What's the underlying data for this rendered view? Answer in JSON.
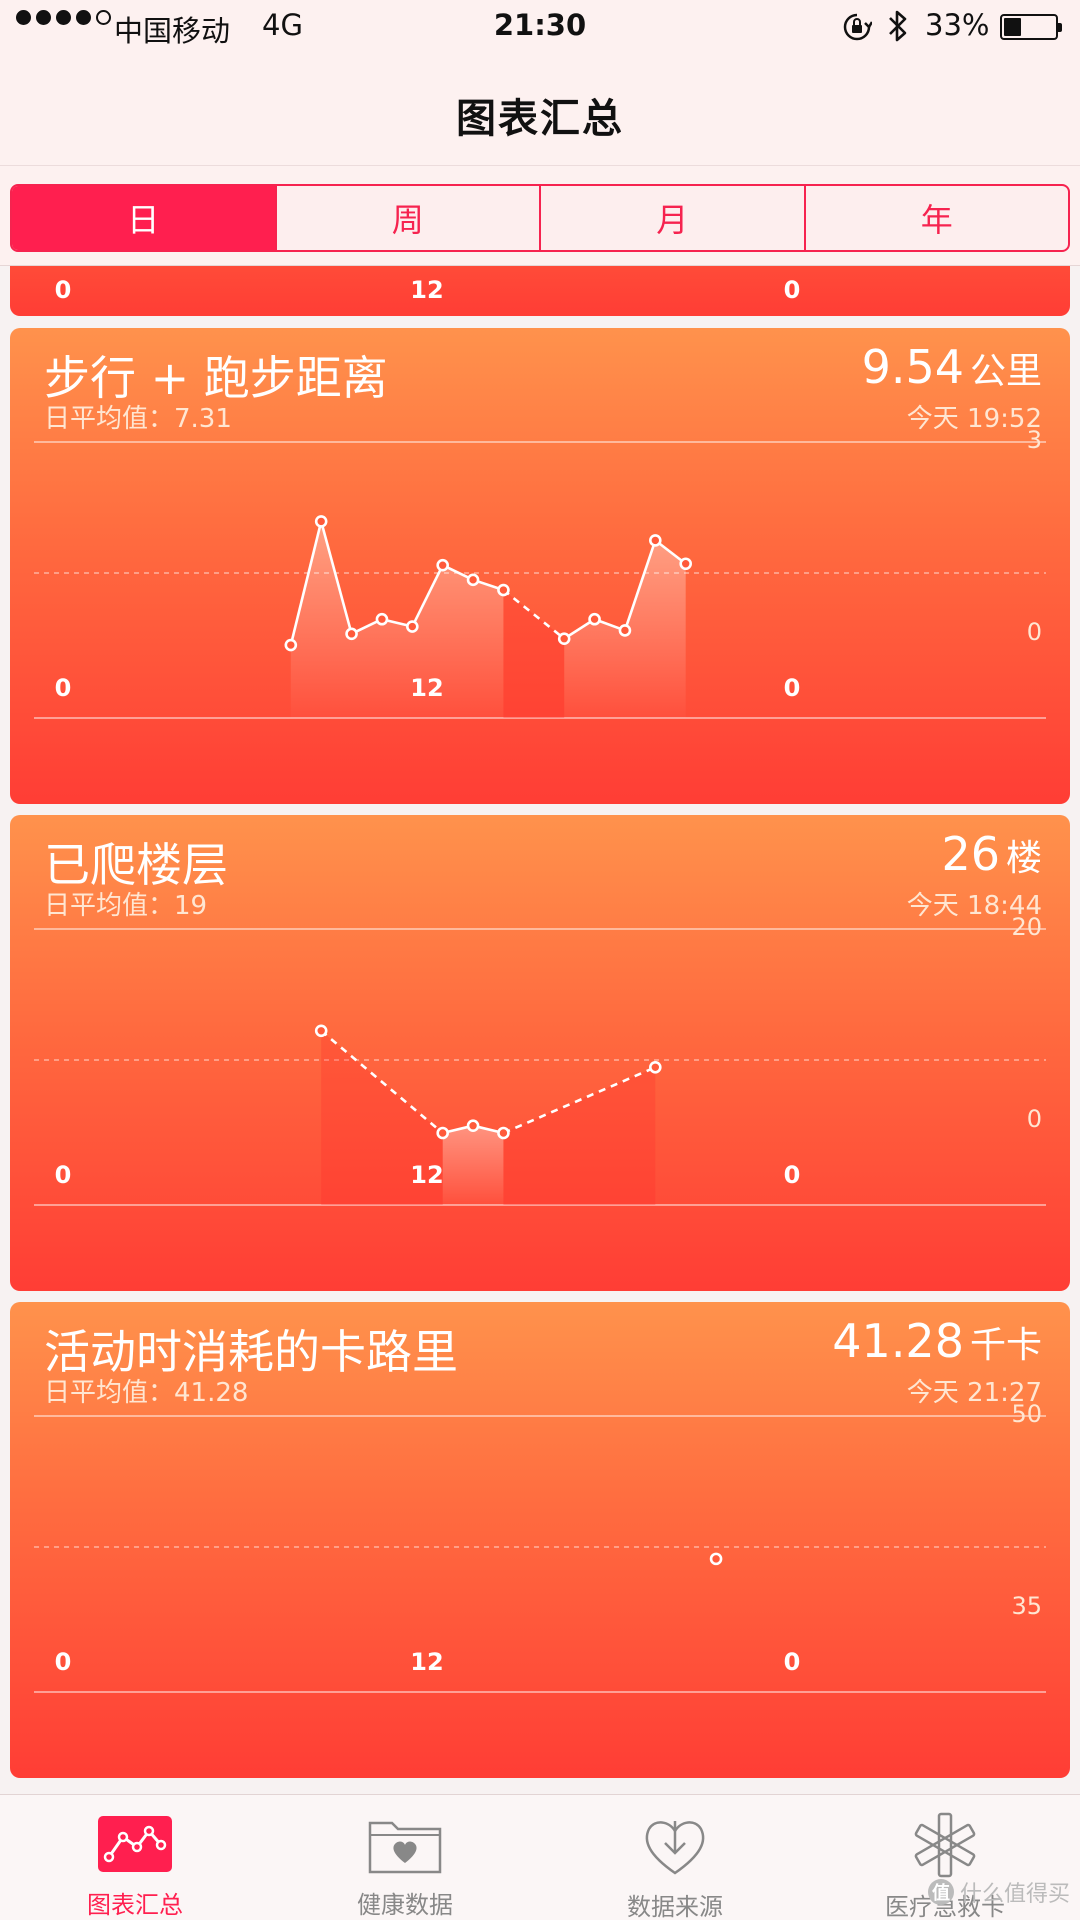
{
  "status_bar": {
    "carrier": "中国移动",
    "network": "4G",
    "time": "21:30",
    "battery_percent": "33%",
    "battery_level": 0.33,
    "signal_bars": 4,
    "icons": [
      "rotation-lock-icon",
      "bluetooth-icon",
      "battery-icon"
    ]
  },
  "nav": {
    "title": "图表汇总"
  },
  "segments": {
    "items": [
      {
        "label": "日",
        "active": true
      },
      {
        "label": "周",
        "active": false
      },
      {
        "label": "月",
        "active": false
      },
      {
        "label": "年",
        "active": false
      }
    ]
  },
  "prev_card": {
    "xticks": [
      "0",
      "12",
      "0"
    ]
  },
  "cards": [
    {
      "title": "步行 + 跑步距离",
      "avg": "日平均值：7.31",
      "value": "9.54",
      "unit": "公里",
      "time": "今天 19:52",
      "ymax_label": "3",
      "ymin_label": "0",
      "xticks": [
        "0",
        "12",
        "0"
      ]
    },
    {
      "title": "已爬楼层",
      "avg": "日平均值：19",
      "value": "26",
      "unit": "楼",
      "time": "今天 18:44",
      "ymax_label": "20",
      "ymin_label": "0",
      "xticks": [
        "0",
        "12",
        "0"
      ]
    },
    {
      "title": "活动时消耗的卡路里",
      "avg": "日平均值：41.28",
      "value": "41.28",
      "unit": "千卡",
      "time": "今天 21:27",
      "ymax_label": "50",
      "ymin_label": "35",
      "xticks": [
        "0",
        "12",
        "0"
      ]
    }
  ],
  "chart_data": [
    {
      "type": "line",
      "x_unit": "hour",
      "xlim": [
        0,
        24
      ],
      "ylim": [
        0,
        3
      ],
      "points": [
        {
          "x": 7.5,
          "y": 0.02,
          "connect": "solid"
        },
        {
          "x": 8.5,
          "y": 2.56,
          "connect": "solid"
        },
        {
          "x": 9.5,
          "y": 0.25,
          "connect": "solid"
        },
        {
          "x": 10.5,
          "y": 0.55,
          "connect": "solid"
        },
        {
          "x": 11.5,
          "y": 0.4,
          "connect": "solid"
        },
        {
          "x": 12.5,
          "y": 1.66,
          "connect": "solid"
        },
        {
          "x": 13.5,
          "y": 1.36,
          "connect": "solid"
        },
        {
          "x": 14.5,
          "y": 1.15,
          "connect": "dashed"
        },
        {
          "x": 16.5,
          "y": 0.15,
          "connect": "solid"
        },
        {
          "x": 17.5,
          "y": 0.55,
          "connect": "solid"
        },
        {
          "x": 18.5,
          "y": 0.32,
          "connect": "solid"
        },
        {
          "x": 19.5,
          "y": 2.17,
          "connect": "solid"
        },
        {
          "x": 20.5,
          "y": 1.69,
          "connect": "none"
        }
      ]
    },
    {
      "type": "line",
      "x_unit": "hour",
      "xlim": [
        0,
        24
      ],
      "ylim": [
        0,
        20
      ],
      "points": [
        {
          "x": 8.5,
          "y": 14,
          "connect": "dashed"
        },
        {
          "x": 12.5,
          "y": 0,
          "connect": "solid"
        },
        {
          "x": 13.5,
          "y": 1,
          "connect": "solid"
        },
        {
          "x": 14.5,
          "y": 0,
          "connect": "dashed"
        },
        {
          "x": 19.5,
          "y": 9,
          "connect": "none"
        }
      ]
    },
    {
      "type": "scatter",
      "x_unit": "hour",
      "xlim": [
        0,
        24
      ],
      "ylim": [
        35,
        50
      ],
      "points": [
        {
          "x": 21.5,
          "y": 41.28,
          "connect": "none"
        }
      ]
    }
  ],
  "tab_bar": {
    "items": [
      {
        "label": "图表汇总",
        "icon": "chart-summary-icon",
        "active": true
      },
      {
        "label": "健康数据",
        "icon": "health-data-folder-icon",
        "active": false
      },
      {
        "label": "数据来源",
        "icon": "data-source-download-icon",
        "active": false
      },
      {
        "label": "医疗急救卡",
        "icon": "medical-id-asterisk-icon",
        "active": false
      }
    ]
  },
  "watermark": {
    "text": "什么值得买",
    "badge": "值"
  },
  "colors": {
    "accent": "#ff1f4f",
    "card_top": "#ff924c",
    "card_bottom": "#ff3d35"
  }
}
